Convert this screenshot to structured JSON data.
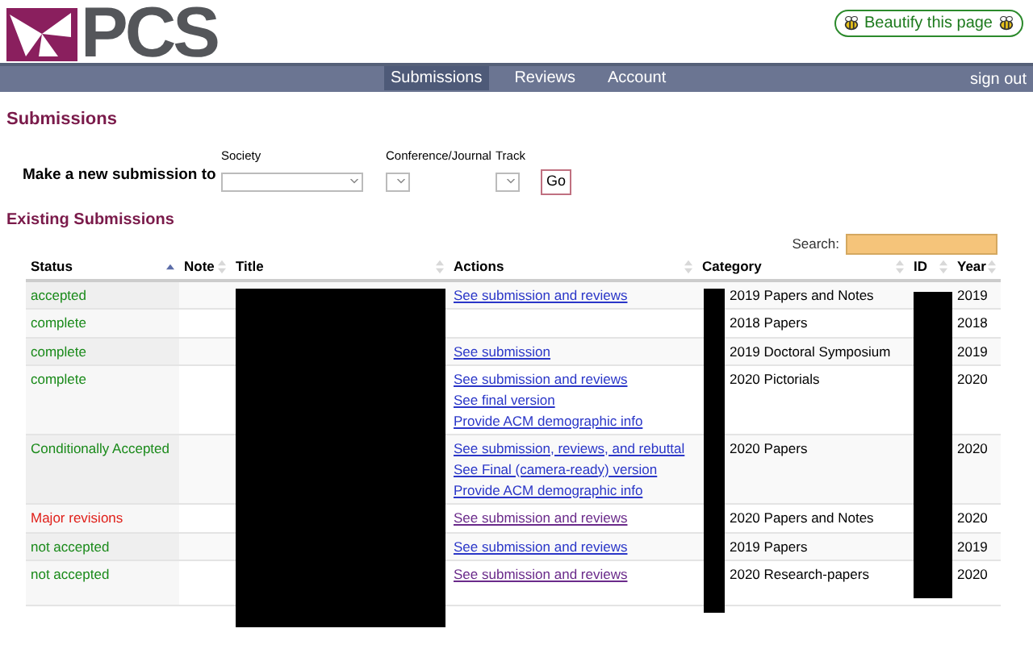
{
  "logo": {
    "text": "PCS"
  },
  "beautify_button": {
    "label": "Beautify this page"
  },
  "nav": [
    {
      "label": "Submissions",
      "selected": true
    },
    {
      "label": "Reviews",
      "selected": false
    },
    {
      "label": "Account",
      "selected": false
    }
  ],
  "sign_out": "sign out",
  "page_title": "Submissions",
  "new_submission": {
    "label": "Make a new submission to",
    "fields": [
      {
        "label": "Society",
        "kind": "wide"
      },
      {
        "label": "Conference/Journal",
        "kind": "narrow"
      },
      {
        "label": "Track",
        "kind": "narrow"
      }
    ],
    "button": "Go"
  },
  "existing_title": "Existing Submissions",
  "search": {
    "label": "Search:"
  },
  "table": {
    "columns": [
      {
        "label": "Status",
        "selected": true
      },
      {
        "label": "Note",
        "selected": false
      },
      {
        "label": "Title",
        "selected": false
      },
      {
        "label": "Actions",
        "selected": false
      },
      {
        "label": "Category",
        "selected": false
      },
      {
        "label": "ID",
        "selected": false
      },
      {
        "label": "Year",
        "selected": false
      }
    ],
    "rows": [
      {
        "status": "accepted",
        "color": "#1a8a1a",
        "actions": [
          {
            "label": "See submission and reviews",
            "visited": false
          }
        ],
        "category": "2019 Papers and Notes",
        "year": "2019"
      },
      {
        "status": "complete",
        "color": "#1a8a1a",
        "actions": [],
        "category": "2018 Papers",
        "year": "2018"
      },
      {
        "status": "complete",
        "color": "#1a8a1a",
        "actions": [
          {
            "label": "See submission",
            "visited": false
          }
        ],
        "category": "2019 Doctoral Symposium",
        "year": "2019"
      },
      {
        "status": "complete",
        "color": "#1a8a1a",
        "actions": [
          {
            "label": "See submission and reviews",
            "visited": false
          },
          {
            "label": "See final version",
            "visited": false
          },
          {
            "label": "Provide ACM demographic info",
            "visited": false
          }
        ],
        "category": "2020 Pictorials",
        "year": "2020"
      },
      {
        "status": "Conditionally Accepted",
        "color": "#1a8a1a",
        "actions": [
          {
            "label": "See submission, reviews, and rebuttal",
            "visited": false
          },
          {
            "label": "See Final (camera-ready) version",
            "visited": false
          },
          {
            "label": "Provide ACM demographic info",
            "visited": false
          }
        ],
        "category": "2020 Papers",
        "year": "2020"
      },
      {
        "status": "Major revisions",
        "color": "#e0201a",
        "actions": [
          {
            "label": "See submission and reviews",
            "visited": true
          }
        ],
        "category": "2020 Papers and Notes",
        "year": "2020"
      },
      {
        "status": "not accepted",
        "color": "#1a8a1a",
        "actions": [
          {
            "label": "See submission and reviews",
            "visited": false
          }
        ],
        "category": "2019 Papers",
        "year": "2019"
      },
      {
        "status": "not accepted",
        "color": "#1a8a1a",
        "actions": [
          {
            "label": "See submission and reviews",
            "visited": true
          }
        ],
        "category": "2020 Research-papers",
        "year": "2020"
      }
    ]
  }
}
